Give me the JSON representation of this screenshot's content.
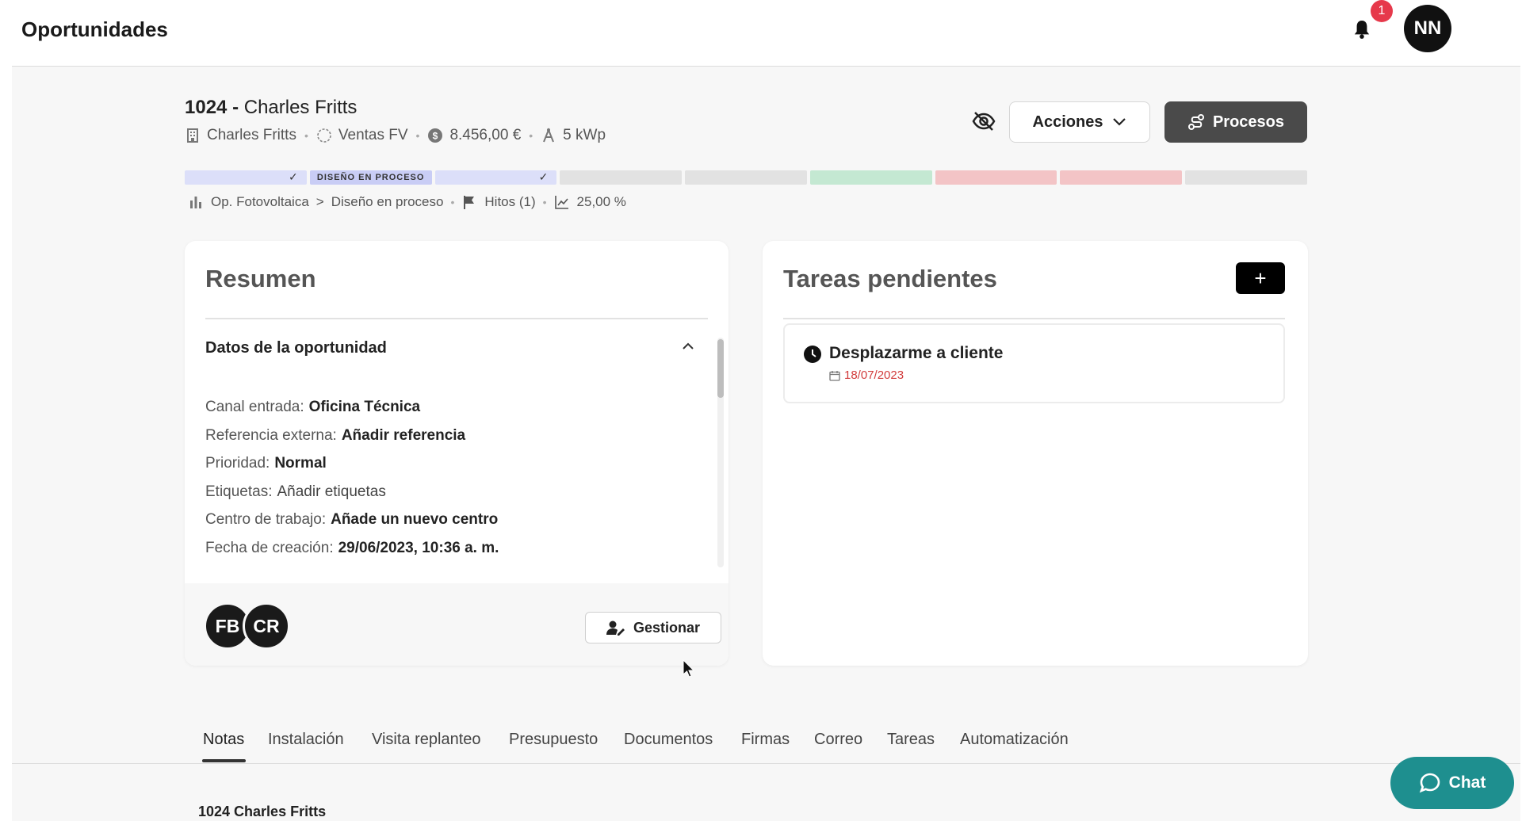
{
  "header": {
    "title": "Oportunidades",
    "notification_count": "1",
    "user_initials": "NN"
  },
  "opportunity": {
    "number": "1024",
    "separator": "-",
    "name": "Charles Fritts",
    "meta": {
      "client": "Charles Fritts",
      "pipeline": "Ventas FV",
      "amount": "8.456,00 €",
      "power": "5 kWp"
    },
    "stages": [
      {
        "label": "",
        "color": "#dcdff9",
        "done": true
      },
      {
        "label": "DISEÑO EN PROCESO",
        "color": "#c9cdf5",
        "done": false
      },
      {
        "label": "",
        "color": "#dcdff9",
        "done": true
      },
      {
        "label": "",
        "color": "#e2e2e2",
        "done": false
      },
      {
        "label": "",
        "color": "#e2e2e2",
        "done": false
      },
      {
        "label": "",
        "color": "#c4e8d2",
        "done": false
      },
      {
        "label": "",
        "color": "#f3c4c6",
        "done": false
      },
      {
        "label": "",
        "color": "#f3c4c6",
        "done": false
      },
      {
        "label": "",
        "color": "#e2e2e2",
        "done": false
      }
    ],
    "breadcrumb": {
      "category": "Op. Fotovoltaica",
      "arrow": ">",
      "stage": "Diseño en proceso",
      "milestones": "Hitos (1)",
      "probability": "25,00 %"
    }
  },
  "actions": {
    "acciones_label": "Acciones",
    "procesos_label": "Procesos"
  },
  "summary": {
    "title": "Resumen",
    "section_title": "Datos de la oportunidad",
    "fields": [
      {
        "label": "Canal entrada:",
        "value": "Oficina Técnica"
      },
      {
        "label": "Referencia externa:",
        "value": "Añadir referencia"
      },
      {
        "label": "Prioridad:",
        "value": "Normal"
      },
      {
        "label": "Etiquetas:",
        "value": "Añadir etiquetas"
      },
      {
        "label": "Centro de trabajo:",
        "value": "Añade un nuevo centro"
      },
      {
        "label": "Fecha de creación:",
        "value": "29/06/2023, 10:36 a. m."
      }
    ],
    "assignees": [
      "FB",
      "CR"
    ],
    "manage_label": "Gestionar"
  },
  "tasks": {
    "title": "Tareas pendientes",
    "add_label": "+",
    "items": [
      {
        "title": "Desplazarme a cliente",
        "date": "18/07/2023"
      }
    ]
  },
  "tabs": [
    "Notas",
    "Instalación",
    "Visita replanteo",
    "Presupuesto",
    "Documentos",
    "Firmas",
    "Correo",
    "Tareas",
    "Automatización"
  ],
  "notes": {
    "heading": "1024 Charles Fritts"
  },
  "chat": {
    "label": "Chat"
  },
  "colors": {
    "accent_dark": "#4a4a4a",
    "chat": "#1e8f8f",
    "badge": "#e6394b",
    "due_date": "#d23b3b"
  }
}
